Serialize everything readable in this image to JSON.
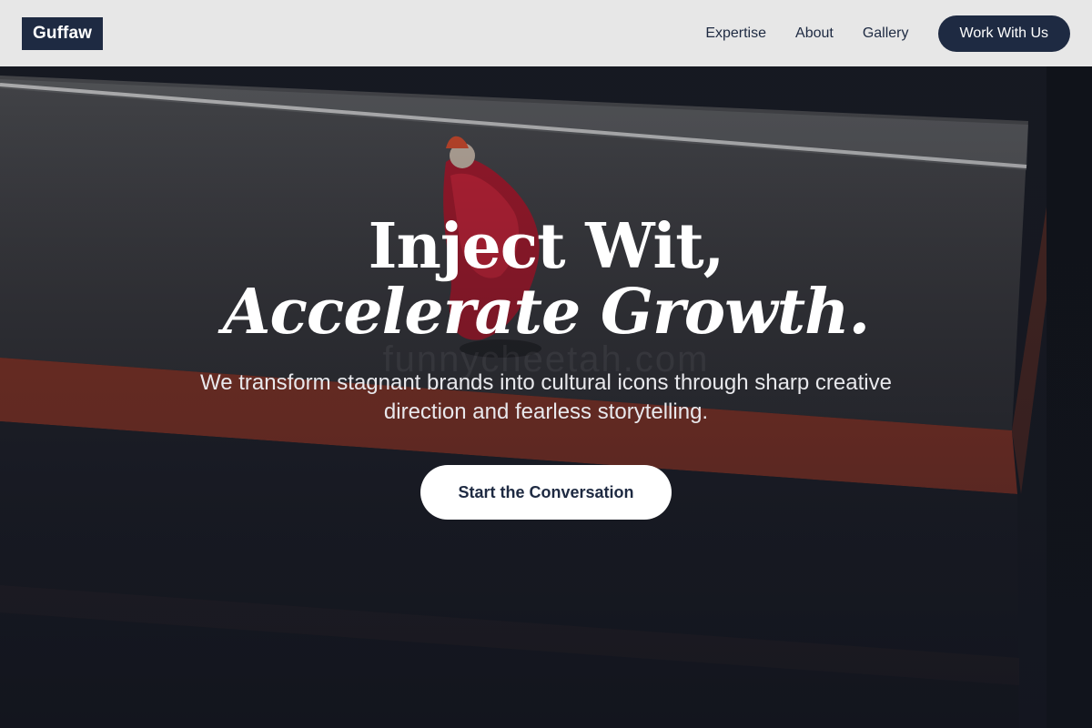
{
  "header": {
    "logo": "Guffaw",
    "nav": [
      "Expertise",
      "About",
      "Gallery"
    ],
    "cta": "Work With Us"
  },
  "hero": {
    "headline_line1": "Inject Wit,",
    "headline_line2": "Accelerate Growth.",
    "subhead": "We transform stagnant brands into cultural icons through sharp creative direction and fearless storytelling.",
    "cta": "Start the Conversation",
    "watermark": "funnycheetah.com",
    "background_image": "red-clad-figure-on-stairs"
  },
  "colors": {
    "header_bg": "#e7e7e7",
    "brand_navy": "#1e2a42",
    "hero_dark": "#151922",
    "stair_red": "#b8432b",
    "figure_red": "#c41e2e",
    "white": "#ffffff"
  }
}
